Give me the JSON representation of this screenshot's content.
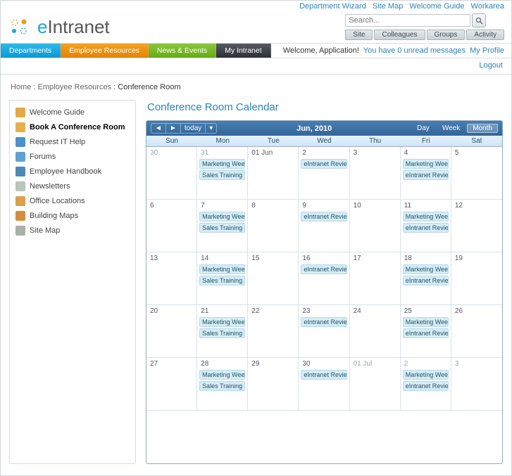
{
  "topLinks": [
    "Department Wizard",
    "Site Map",
    "Welcome Guide",
    "Workarea"
  ],
  "logo": {
    "brand_e": "e",
    "brand_rest": "Intranet"
  },
  "search": {
    "placeholder": "Search...",
    "tabs": [
      "Site",
      "Colleagues",
      "Groups",
      "Activity"
    ]
  },
  "nav": {
    "dept": "Departments",
    "emp": "Employee Resources",
    "news": "News & Events",
    "my": "My Intranet"
  },
  "user": {
    "welcome": "Welcome, Application!",
    "messages": "You have 0 unread messages",
    "profile": "My Profile",
    "logout": "Logout"
  },
  "breadcrumbs": {
    "home": "Home",
    "sep": ":",
    "section": "Employee Resources",
    "current": "Conference Room"
  },
  "sidebar": {
    "items": [
      {
        "label": "Welcome Guide",
        "color": "#e2a94a"
      },
      {
        "label": "Book A Conference Room",
        "color": "#e8b04d",
        "active": true
      },
      {
        "label": "Request IT Help",
        "color": "#4c92c8"
      },
      {
        "label": "Forums",
        "color": "#5fa2d1"
      },
      {
        "label": "Employee Handbook",
        "color": "#4f88b3"
      },
      {
        "label": "Newsletters",
        "color": "#b8c5ba"
      },
      {
        "label": "Office Locations",
        "color": "#d9a14a"
      },
      {
        "label": "Building Maps",
        "color": "#d48d3f"
      },
      {
        "label": "Site Map",
        "color": "#a8b0a8"
      }
    ]
  },
  "page_title": "Conference Room Calendar",
  "calendar": {
    "todayLabel": "today",
    "title": "Jun, 2010",
    "views": {
      "day": "Day",
      "week": "Week",
      "month": "Month"
    },
    "dayNames": [
      "Sun",
      "Mon",
      "Tue",
      "Wed",
      "Thu",
      "Fri",
      "Sat"
    ],
    "eventTypes": {
      "mw": "Marketing Weekly",
      "st": "Sales Training",
      "er": "eIntranet Review"
    },
    "days": [
      {
        "n": "30",
        "other": true
      },
      {
        "n": "31",
        "other": true,
        "ev": [
          "mw",
          "st"
        ]
      },
      {
        "n": "01 Jun"
      },
      {
        "n": "2",
        "ev": [
          "er"
        ]
      },
      {
        "n": "3"
      },
      {
        "n": "4",
        "ev": [
          "mw",
          "er"
        ]
      },
      {
        "n": "5"
      },
      {
        "n": "6"
      },
      {
        "n": "7",
        "ev": [
          "mw",
          "st"
        ]
      },
      {
        "n": "8"
      },
      {
        "n": "9",
        "ev": [
          "er"
        ]
      },
      {
        "n": "10"
      },
      {
        "n": "11",
        "ev": [
          "mw",
          "er"
        ]
      },
      {
        "n": "12"
      },
      {
        "n": "13"
      },
      {
        "n": "14",
        "ev": [
          "mw",
          "st"
        ]
      },
      {
        "n": "15"
      },
      {
        "n": "16",
        "ev": [
          "er"
        ]
      },
      {
        "n": "17"
      },
      {
        "n": "18",
        "ev": [
          "mw",
          "er"
        ]
      },
      {
        "n": "19"
      },
      {
        "n": "20"
      },
      {
        "n": "21",
        "ev": [
          "mw",
          "st"
        ]
      },
      {
        "n": "22"
      },
      {
        "n": "23",
        "ev": [
          "er"
        ]
      },
      {
        "n": "24"
      },
      {
        "n": "25",
        "ev": [
          "mw",
          "er"
        ]
      },
      {
        "n": "26"
      },
      {
        "n": "27"
      },
      {
        "n": "28",
        "ev": [
          "mw",
          "st"
        ]
      },
      {
        "n": "29"
      },
      {
        "n": "30",
        "ev": [
          "er"
        ]
      },
      {
        "n": "01 Jul",
        "other": true
      },
      {
        "n": "2",
        "other": true,
        "ev": [
          "mw",
          "er"
        ]
      },
      {
        "n": "3",
        "other": true
      }
    ]
  }
}
